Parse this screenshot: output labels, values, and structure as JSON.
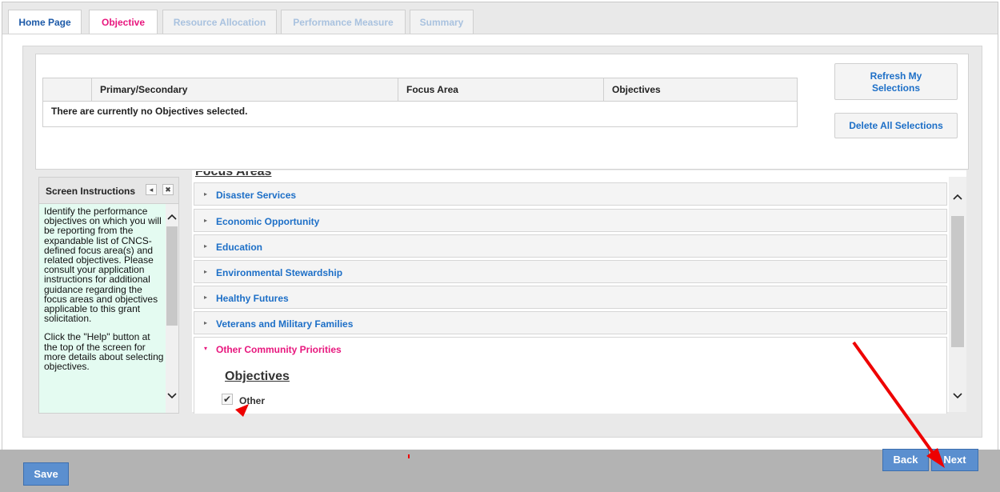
{
  "tabs": {
    "home": "Home Page",
    "objective": "Objective",
    "resource": "Resource Allocation",
    "performance": "Performance Measure",
    "summary": "Summary"
  },
  "selections": {
    "columns": [
      "",
      "Primary/Secondary",
      "Focus Area",
      "Objectives"
    ],
    "empty_message": "There are currently no Objectives selected.",
    "refresh_label_1": "Refresh My",
    "refresh_label_2": "Selections",
    "delete_all_label": "Delete All Selections"
  },
  "instructions": {
    "title": "Screen Instructions",
    "collapse_icon": "◂",
    "close_icon": "✖",
    "paragraph_1": "Identify the performance objectives on which you will be reporting from the expandable list of CNCS-defined focus area(s) and related objectives. Please consult your application instructions for additional guidance regarding the focus areas and objectives applicable to this grant solicitation.",
    "paragraph_2": "Click the \"Help\" button at the top of the screen for more details about selecting objectives."
  },
  "focus_areas": {
    "heading": "Focus Areas",
    "items": [
      "Disaster Services",
      "Economic Opportunity",
      "Education",
      "Environmental Stewardship",
      "Healthy Futures",
      "Veterans and Military Families",
      "Other Community Priorities"
    ],
    "open_item": "Other Community Priorities",
    "objectives_heading": "Objectives",
    "objective_option": "Other",
    "objective_checked": true
  },
  "buttons": {
    "save": "Save",
    "back": "Back",
    "next": "Next"
  },
  "colors": {
    "accent_blue": "#1d6fc7",
    "accent_pink": "#e8177e",
    "annotation_red": "#ee0000"
  },
  "icons": {
    "collapsed": "▸",
    "expanded": "▾",
    "up": "^",
    "down": "v",
    "check": "✔"
  }
}
